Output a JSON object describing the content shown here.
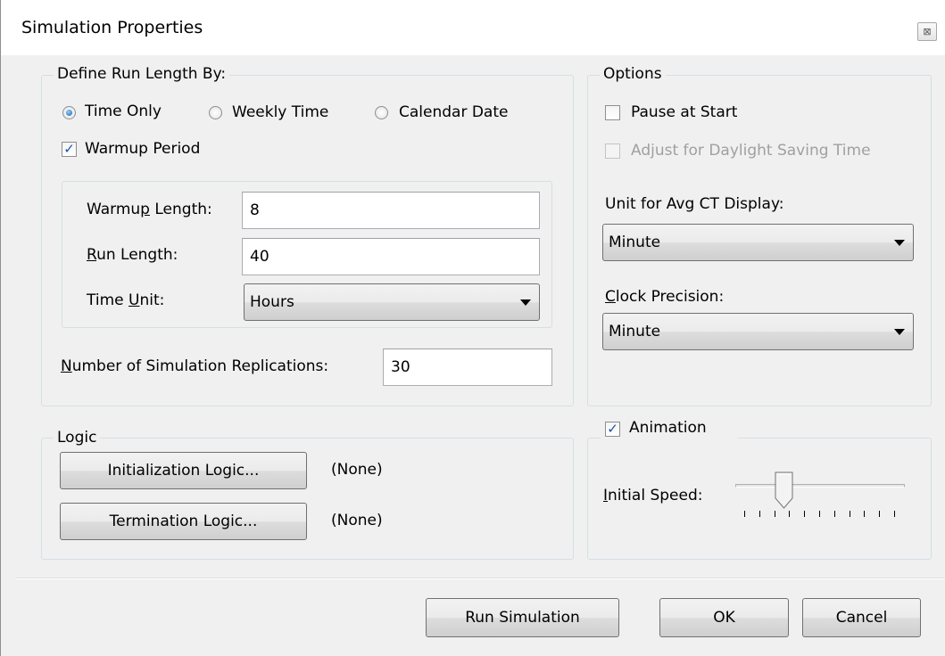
{
  "window": {
    "title": "Simulation Properties",
    "close_glyph": "⊠"
  },
  "run_length": {
    "legend": "Define Run Length By:",
    "mode_options": [
      "Time Only",
      "Weekly Time",
      "Calendar Date"
    ],
    "selected_mode": "Time Only",
    "warmup_checked": true,
    "warmup_label": "Warmup Period",
    "warmup_length_label_pre": "Warmu",
    "warmup_length_label_u": "p",
    "warmup_length_label_post": " Length:",
    "warmup_length_value": "8",
    "run_length_label_u": "R",
    "run_length_label_post": "un Length:",
    "run_length_value": "40",
    "time_unit_label_pre": "Time ",
    "time_unit_label_u": "U",
    "time_unit_label_post": "nit:",
    "time_unit_value": "Hours",
    "replications_label_u": "N",
    "replications_label_post": "umber of Simulation Replications:",
    "replications_value": "30"
  },
  "options": {
    "legend": "Options",
    "pause_checked": false,
    "pause_label": "Pause at Start",
    "daylight_checked": false,
    "daylight_enabled": false,
    "daylight_label": "Adjust for Daylight Saving Time",
    "avg_ct_label": "Unit for Avg CT Display:",
    "avg_ct_value": "Minute",
    "clock_label_u": "C",
    "clock_label_post": "lock Precision:",
    "clock_value": "Minute"
  },
  "logic": {
    "legend": "Logic",
    "init_button": "Initialization Logic...",
    "init_status": "(None)",
    "term_button": "Termination Logic...",
    "term_status": "(None)"
  },
  "animation": {
    "checked": true,
    "label": "Animation",
    "speed_label_u": "I",
    "speed_label_post": "nitial Speed:",
    "speed_fraction": 0.27,
    "tick_count": 11
  },
  "footer": {
    "run_button": "Run Simulation",
    "ok_button": "OK",
    "cancel_button": "Cancel"
  },
  "colors": {
    "accent": "#1a5fb4",
    "check": "#2050a8"
  }
}
